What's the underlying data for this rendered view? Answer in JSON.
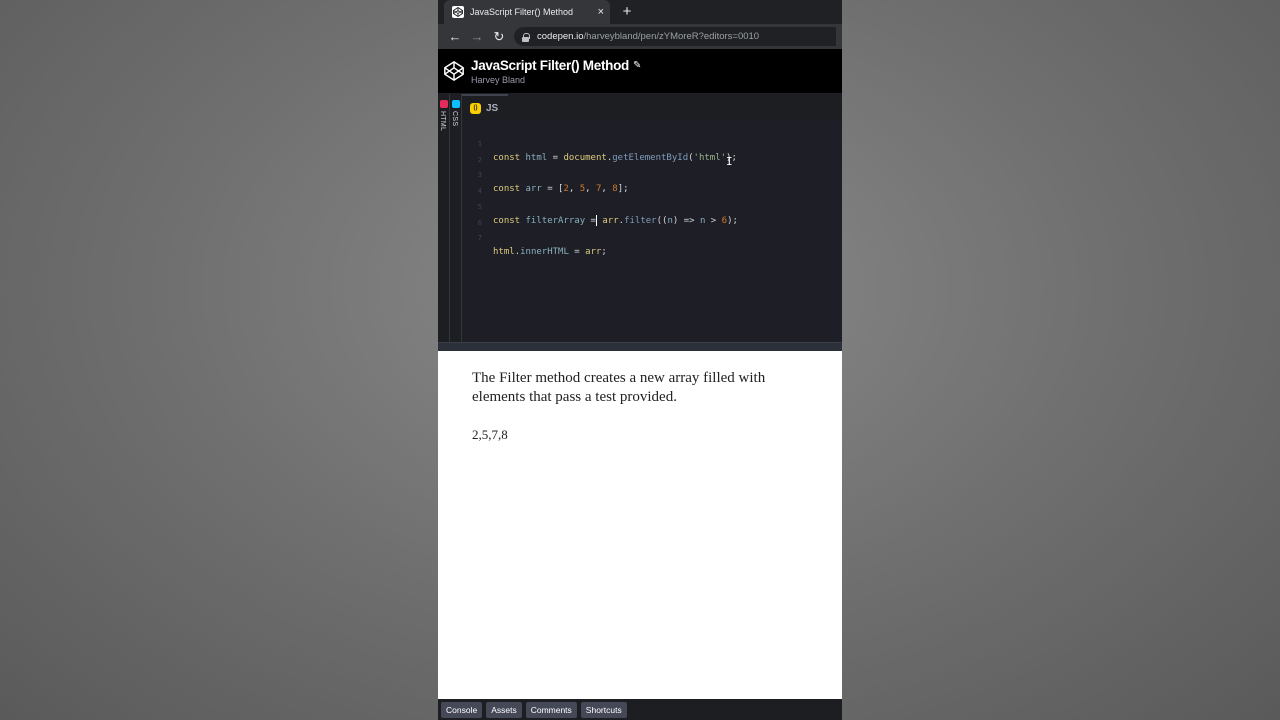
{
  "browser": {
    "tab_title": "JavaScript Filter() Method",
    "tab_close": "×",
    "new_tab": "+",
    "url_host": "codepen.io",
    "url_path": "/harveybland/pen/zYMoreR?editors=0010"
  },
  "pen": {
    "title": "JavaScript Filter() Method",
    "author": "Harvey Bland"
  },
  "collapsed_editors": [
    {
      "label": "HTML",
      "color": "#e42c5a"
    },
    {
      "label": "CSS",
      "color": "#0ebeff"
    }
  ],
  "js_tab": {
    "label": "JS",
    "badge": "()"
  },
  "code": {
    "line_numbers": [
      "1",
      "2",
      "3",
      "4",
      "5",
      "6",
      "7"
    ],
    "l1": {
      "kw": "const",
      "var": "html",
      "eq": " = ",
      "obj": "document",
      "dot": ".",
      "fn": "getElementById",
      "open": "(",
      "str": "'html'",
      "close": ");"
    },
    "l3": {
      "kw": "const",
      "var": "arr",
      "eq": " = ",
      "open": "[",
      "n1": "2",
      "n2": "5",
      "n3": "7",
      "n4": "8",
      "sep": ", ",
      "close": "];"
    },
    "l5": {
      "kw": "const",
      "var": "filterArray",
      "eq": " =",
      "obj": "arr",
      "dot": ".",
      "fn": "filter",
      "open": "((",
      "param": "n",
      "arrow": ") => ",
      "cmp_var": "n",
      "gt": " > ",
      "num": "6",
      "close": ");"
    },
    "l7": {
      "obj": "html",
      "dot": ".",
      "prop": "innerHTML",
      "eq": " = ",
      "var": "arr",
      "close": ";"
    }
  },
  "result": {
    "description": "The Filter method creates a new array filled with elements that pass a test provided.",
    "output": "2,5,7,8"
  },
  "bottom_bar": [
    "Console",
    "Assets",
    "Comments",
    "Shortcuts"
  ]
}
